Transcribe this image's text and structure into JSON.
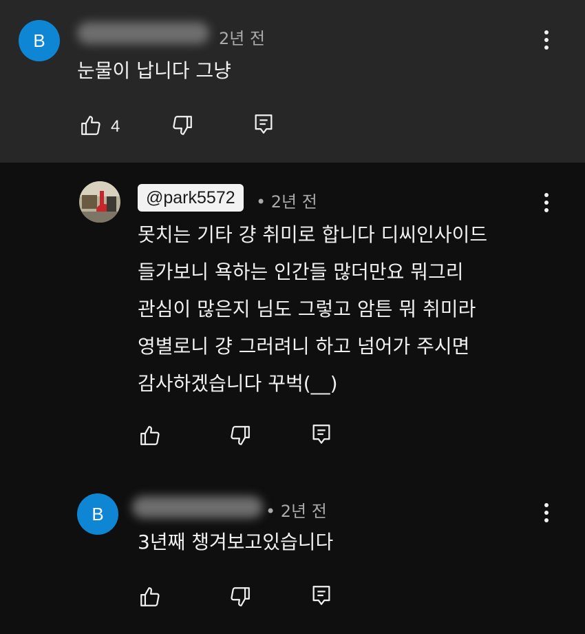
{
  "comments": [
    {
      "avatar_letter": "B",
      "author": "",
      "time": "2년 전",
      "text_lines": [
        "눈물이 납니다 그냥"
      ],
      "likes": "4"
    },
    {
      "author": "@park5572",
      "time": "• 2년 전",
      "text_lines": [
        "못치는 기타 걍 취미로 합니다 디씨인사이드",
        "들가보니 욕하는 인간들 많더만요 뭐그리",
        "관심이 많은지 님도 그렇고 암튼 뭐 취미라",
        "영별로니 걍 그러려니 하고 넘어가 주시면",
        "감사하겠습니다 꾸벅(__)"
      ]
    },
    {
      "avatar_letter": "B",
      "author": "",
      "time": "• 2년 전",
      "text_lines": [
        "3년째 챙겨보고있습니다"
      ]
    }
  ],
  "icons": {
    "like": "thumbs-up-icon",
    "dislike": "thumbs-down-icon",
    "reply": "reply-comment-icon",
    "more": "more-vert-icon"
  },
  "colors": {
    "avatar_blue": "#0f86d4",
    "top_bg": "#272727",
    "page_bg": "#0f0f0f"
  }
}
